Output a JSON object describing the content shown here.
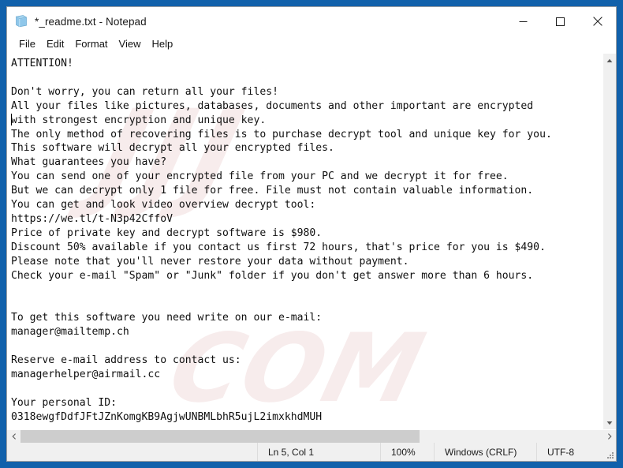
{
  "window": {
    "title": "*_readme.txt - Notepad",
    "icon": "notepad-icon",
    "controls": {
      "minimize_label": "–",
      "maximize_label": "☐",
      "close_label": "✕"
    }
  },
  "menu": {
    "items": [
      {
        "label": "File"
      },
      {
        "label": "Edit"
      },
      {
        "label": "Format"
      },
      {
        "label": "View"
      },
      {
        "label": "Help"
      }
    ]
  },
  "document": {
    "text": "ATTENTION!\n\nDon't worry, you can return all your files!\nAll your files like pictures, databases, documents and other important are encrypted\nwith strongest encryption and unique key.\nThe only method of recovering files is to purchase decrypt tool and unique key for you.\nThis software will decrypt all your encrypted files.\nWhat guarantees you have?\nYou can send one of your encrypted file from your PC and we decrypt it for free.\nBut we can decrypt only 1 file for free. File must not contain valuable information.\nYou can get and look video overview decrypt tool:\nhttps://we.tl/t-N3p42CffoV\nPrice of private key and decrypt software is $980.\nDiscount 50% available if you contact us first 72 hours, that's price for you is $490.\nPlease note that you'll never restore your data without payment.\nCheck your e-mail \"Spam\" or \"Junk\" folder if you don't get answer more than 6 hours.\n\n\nTo get this software you need write on our e-mail:\nmanager@mailtemp.ch\n\nReserve e-mail address to contact us:\nmanagerhelper@airmail.cc\n\nYour personal ID:\n0318ewgfDdfJFtJZnKomgKB9AgjwUNBMLbhR5ujL2imxkhdMUH",
    "price_full": "$980",
    "price_discount": "$490",
    "video_url": "https://we.tl/t-N3p42CffoV",
    "email_primary": "manager@mailtemp.ch",
    "email_reserve": "managerhelper@airmail.cc",
    "personal_id": "0318ewgfDdfJFtJZnKomgKB9AgjwUNBMLbhR5ujL2imxkhdMUH"
  },
  "watermark": {
    "line1": "JJJ",
    "line2": "COM"
  },
  "scrollbars": {
    "vertical": {
      "up_arrow": "▲",
      "down_arrow": "▼"
    },
    "horizontal": {
      "left_arrow": "❮",
      "right_arrow": "❯"
    }
  },
  "status_bar": {
    "cursor_position": "Ln 5, Col 1",
    "zoom": "100%",
    "line_ending": "Windows (CRLF)",
    "encoding": "UTF-8"
  },
  "colors": {
    "desktop_blue": "#1161ab",
    "window_bg": "#ffffff",
    "status_bg": "#f0f0f0",
    "scrollbar_thumb": "#cdcdcd",
    "text": "#0f0f0f"
  }
}
